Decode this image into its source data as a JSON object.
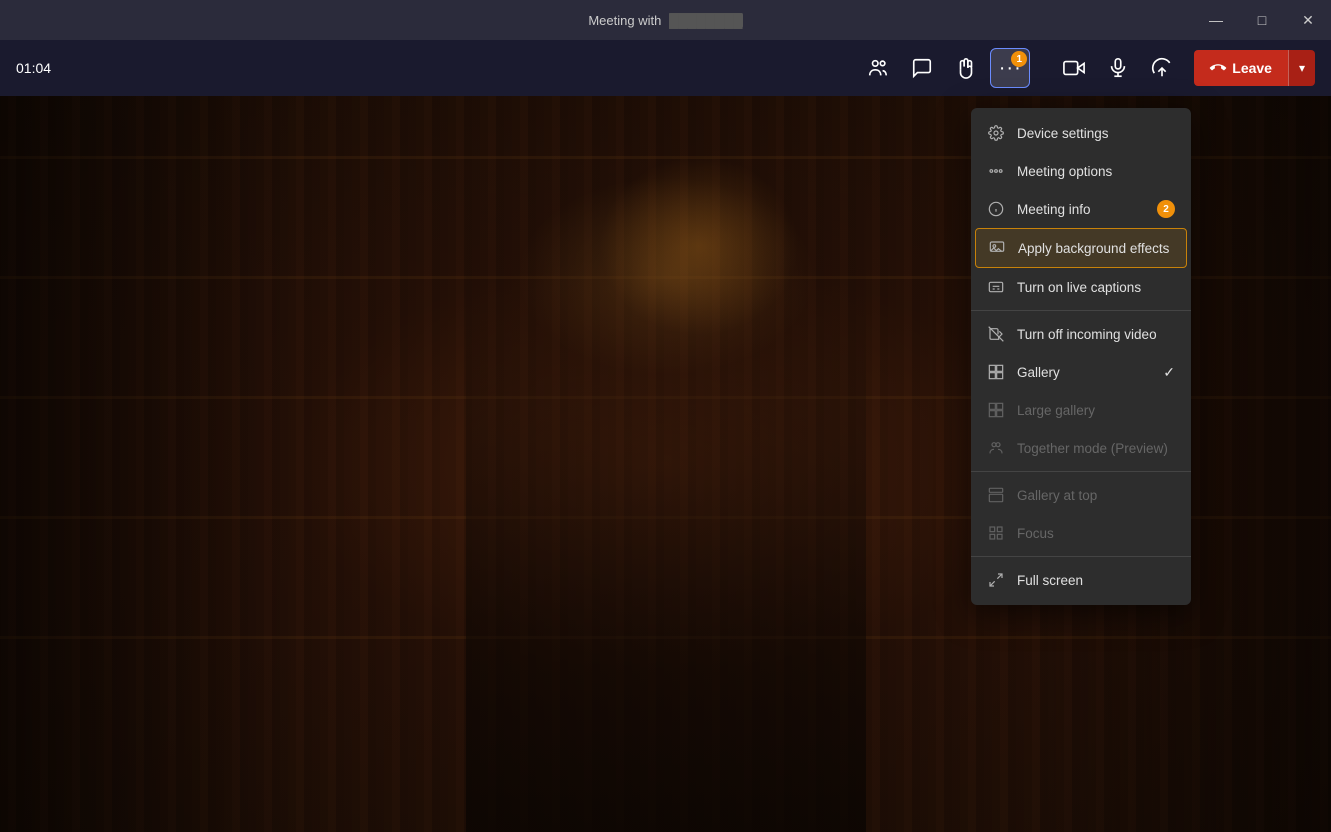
{
  "titleBar": {
    "title": "Meeting with",
    "titleBlurred": "████████",
    "minBtn": "—",
    "maxBtn": "□",
    "closeBtn": "✕"
  },
  "toolbar": {
    "timer": "01:04",
    "moreOptionsLabel": "···",
    "moreBadge": "1",
    "leaveBtnLabel": "Leave"
  },
  "dropdown": {
    "items": [
      {
        "id": "device-settings",
        "label": "Device settings",
        "icon": "gear",
        "disabled": false,
        "badge": null,
        "check": false
      },
      {
        "id": "meeting-options",
        "label": "Meeting options",
        "icon": "options",
        "disabled": false,
        "badge": null,
        "check": false
      },
      {
        "id": "meeting-info",
        "label": "Meeting info",
        "icon": "info",
        "disabled": false,
        "badge": "2",
        "check": false
      },
      {
        "id": "apply-background",
        "label": "Apply background effects",
        "icon": "background",
        "disabled": false,
        "badge": null,
        "check": false,
        "highlighted": true
      },
      {
        "id": "live-captions",
        "label": "Turn on live captions",
        "icon": "captions",
        "disabled": false,
        "badge": null,
        "check": false
      },
      {
        "id": "divider1",
        "type": "divider"
      },
      {
        "id": "turn-off-video",
        "label": "Turn off incoming video",
        "icon": "video-off",
        "disabled": false,
        "badge": null,
        "check": false
      },
      {
        "id": "gallery",
        "label": "Gallery",
        "icon": "gallery",
        "disabled": false,
        "badge": null,
        "check": true
      },
      {
        "id": "large-gallery",
        "label": "Large gallery",
        "icon": "large-gallery",
        "disabled": true,
        "badge": null,
        "check": false
      },
      {
        "id": "together-mode",
        "label": "Together mode (Preview)",
        "icon": "together",
        "disabled": true,
        "badge": null,
        "check": false
      },
      {
        "id": "divider2",
        "type": "divider"
      },
      {
        "id": "gallery-top",
        "label": "Gallery at top",
        "icon": "gallery-top",
        "disabled": true,
        "badge": null,
        "check": false
      },
      {
        "id": "focus",
        "label": "Focus",
        "icon": "focus",
        "disabled": true,
        "badge": null,
        "check": false
      },
      {
        "id": "divider3",
        "type": "divider"
      },
      {
        "id": "full-screen",
        "label": "Full screen",
        "icon": "fullscreen",
        "disabled": false,
        "badge": null,
        "check": false
      }
    ]
  },
  "colors": {
    "leaveRed": "#c42b1c",
    "badgeOrange": "#f0900a",
    "highlightBorder": "#c8820a",
    "toolbarBg": "#1a1a2e",
    "titleBg": "#2b2b3b",
    "menuBg": "#2d2d2d"
  }
}
